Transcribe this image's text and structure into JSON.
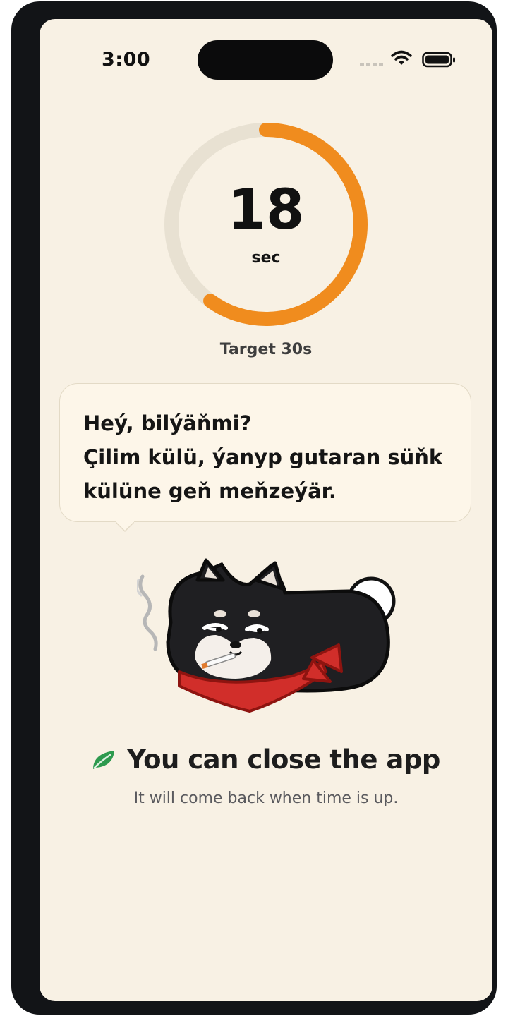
{
  "status_bar": {
    "time": "3:00",
    "icons": [
      "cellular-signal-icon",
      "wifi-icon",
      "battery-icon"
    ]
  },
  "timer": {
    "value": "18",
    "unit": "sec",
    "target_label": "Target 30s",
    "elapsed_seconds": 18,
    "target_seconds": 30,
    "progress_color": "#f08c1e",
    "track_color": "#e8e1d2"
  },
  "speech_bubble": {
    "lines": [
      "Heý, bilýäňmi?",
      "Çilim külü, ýanyp gutaran süňk",
      "külüne geň meňzeýär."
    ]
  },
  "mascot": {
    "icon": "shiba-dog-smoking-icon"
  },
  "close_notice": {
    "icon": "leaf-icon",
    "title": "You can close the app",
    "subtitle": "It will come back when time is up."
  },
  "colors": {
    "background": "#f8f1e4",
    "accent": "#f08c1e",
    "leaf": "#2e9a4e",
    "bandana": "#d12e2a"
  }
}
